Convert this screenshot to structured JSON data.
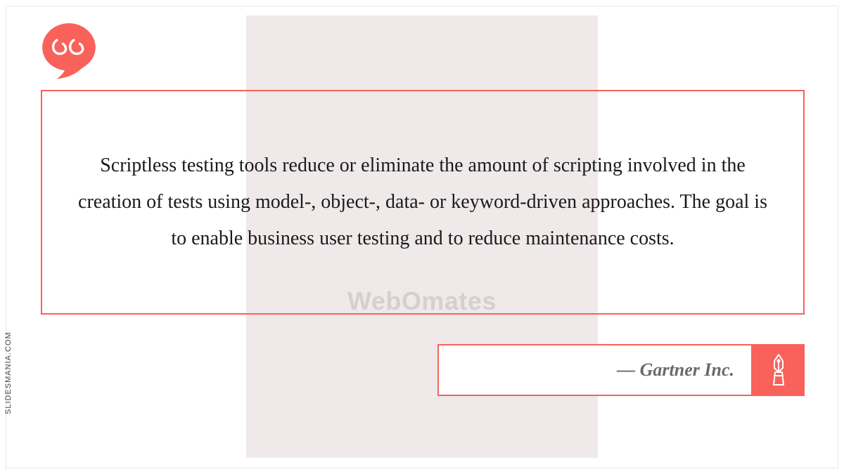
{
  "colors": {
    "accent": "#f8625a",
    "band": "#efe9ea",
    "text": "#1a1a1a",
    "attr_text": "#6a6a6a"
  },
  "quote": {
    "body": "Scriptless testing tools reduce or eliminate the amount of scripting involved in the creation of tests using model-, object-, data- or keyword-driven approaches. The goal is to enable business user testing and to reduce maintenance costs.",
    "attribution_prefix": "— ",
    "attribution": "Gartner Inc."
  },
  "watermark": "WebOmates",
  "credit": "SLIDESMANIA.COM",
  "icons": {
    "quote_mark": "quote-mark-icon",
    "pen": "fountain-pen-icon"
  }
}
